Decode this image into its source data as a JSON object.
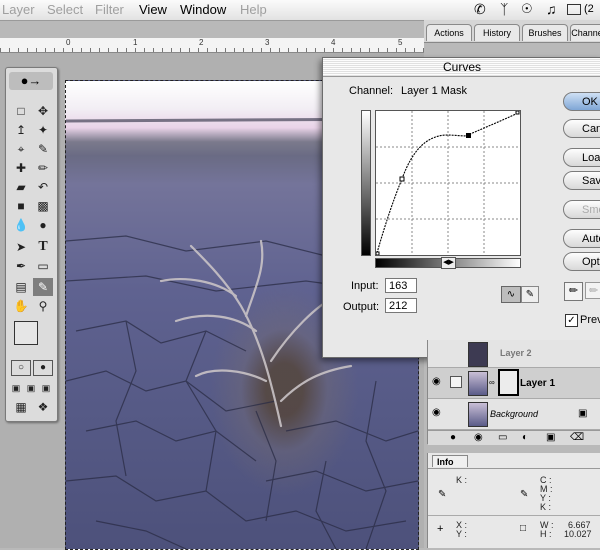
{
  "menubar": {
    "items": [
      "Layer",
      "Select",
      "Filter",
      "View",
      "Window",
      "Help"
    ],
    "clock": "(2"
  },
  "palette_tabs": [
    "Actions",
    "History",
    "Brushes",
    "Channe"
  ],
  "ruler": {
    "numbers": [
      "0",
      "1",
      "2",
      "3",
      "4",
      "5"
    ]
  },
  "curves": {
    "title": "Curves",
    "channel_label": "Channel:",
    "channel_value": "Layer 1 Mask",
    "input_label": "Input:",
    "input_value": "163",
    "output_label": "Output:",
    "output_value": "212",
    "buttons": [
      "OK",
      "Cancel",
      "Load...",
      "Save...",
      "Smooth",
      "Auto",
      "Options..."
    ],
    "preview_label": "Preview",
    "preview_checked": true
  },
  "layers": {
    "rows": [
      {
        "name": "Layer 2"
      },
      {
        "name": "Layer 1",
        "selected": true
      },
      {
        "name": "Background",
        "italic": true
      }
    ]
  },
  "info": {
    "tab": "Info",
    "k_label": "K :",
    "cmyk_labels": [
      "C :",
      "M :",
      "Y :",
      "K :"
    ],
    "xy_labels": [
      "X :",
      "Y :"
    ],
    "w_label": "W :",
    "w_value": "6.667",
    "h_label": "H :",
    "h_value": "10.027"
  }
}
